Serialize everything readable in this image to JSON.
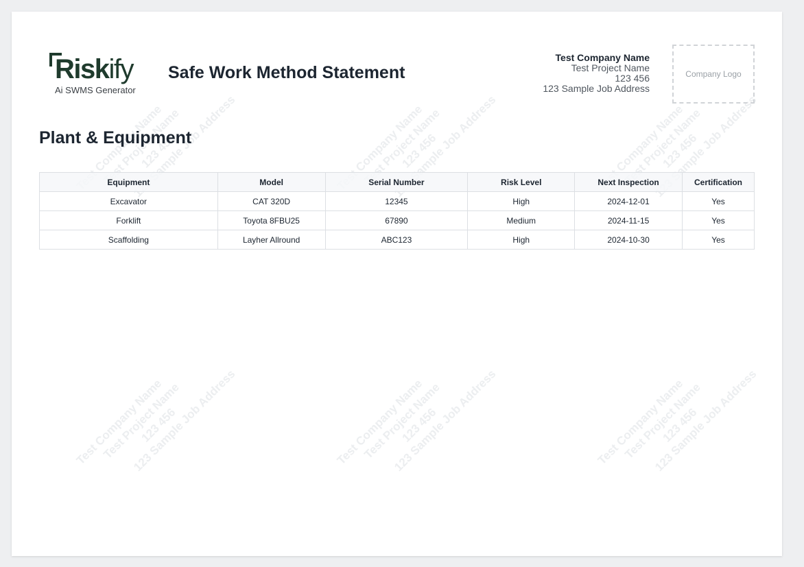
{
  "brand": {
    "logo_text_bold": "Risk",
    "logo_text_light": "ify",
    "logo_tagline": "Ai SWMS Generator"
  },
  "document": {
    "title": "Safe Work Method Statement",
    "section_title": "Plant & Equipment"
  },
  "company": {
    "name": "Test Company Name",
    "project": "Test Project Name",
    "number": "123 456",
    "address": "123 Sample Job Address",
    "logo_placeholder": "Company Logo"
  },
  "watermark": {
    "lines": [
      "Test Company Name",
      "Test Project Name",
      "123 456",
      "123 Sample Job Address"
    ]
  },
  "equipment_table": {
    "headers": [
      "Equipment",
      "Model",
      "Serial Number",
      "Risk Level",
      "Next Inspection",
      "Certification"
    ],
    "rows": [
      [
        "Excavator",
        "CAT 320D",
        "12345",
        "High",
        "2024-12-01",
        "Yes"
      ],
      [
        "Forklift",
        "Toyota 8FBU25",
        "67890",
        "Medium",
        "2024-11-15",
        "Yes"
      ],
      [
        "Scaffolding",
        "Layher Allround",
        "ABC123",
        "High",
        "2024-10-30",
        "Yes"
      ]
    ]
  },
  "colors": {
    "brand_green": "#1f3b2d",
    "text_dark": "#1c2530",
    "border": "#dcdfe3"
  }
}
